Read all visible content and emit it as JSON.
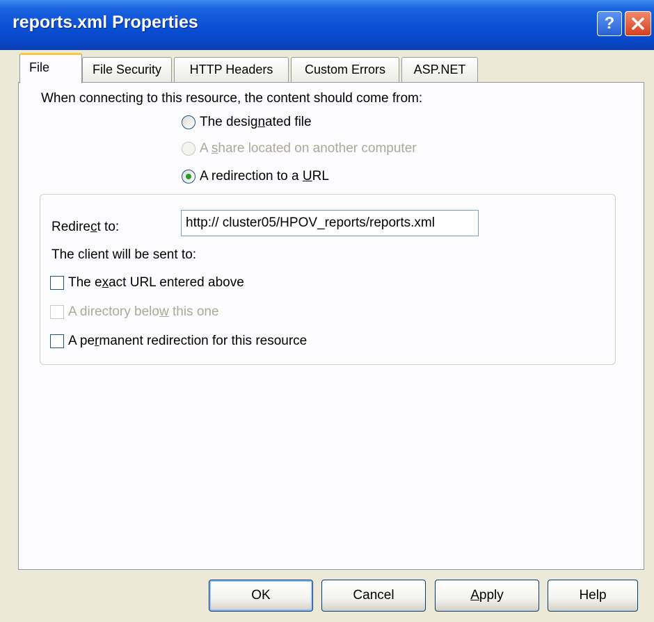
{
  "window": {
    "title": "reports.xml Properties",
    "help_glyph": "?",
    "titlebar_color": "#0a4fd4"
  },
  "tabs": [
    {
      "label": "File",
      "active": true
    },
    {
      "label": "File Security",
      "active": false
    },
    {
      "label": "HTTP Headers",
      "active": false
    },
    {
      "label": "Custom Errors",
      "active": false
    },
    {
      "label": "ASP.NET",
      "active": false
    }
  ],
  "content_source": {
    "intro": "When connecting to this resource, the content should come from:",
    "options": [
      {
        "pre": "The desig",
        "accel": "n",
        "post": "ated file",
        "selected": false,
        "enabled": true
      },
      {
        "pre": "A ",
        "accel": "s",
        "post": "hare located on another computer",
        "selected": false,
        "enabled": false
      },
      {
        "pre": "A redirection to a ",
        "accel": "U",
        "post": "RL",
        "selected": true,
        "enabled": true
      }
    ]
  },
  "redirect": {
    "label_pre": "Redire",
    "label_accel": "c",
    "label_post": "t to:",
    "url": "http:// cluster05/HPOV_reports/reports.xml",
    "client_label": "The client will be sent to:",
    "checkboxes": [
      {
        "pre": "The e",
        "accel": "x",
        "post": "act URL entered above",
        "checked": false,
        "enabled": true
      },
      {
        "pre": "A directory belo",
        "accel": "w",
        "post": " this one",
        "checked": false,
        "enabled": false
      },
      {
        "pre": "A pe",
        "accel": "r",
        "post": "manent redirection for this resource",
        "checked": false,
        "enabled": true
      }
    ]
  },
  "buttons": {
    "ok": "OK",
    "cancel": "Cancel",
    "apply_accel": "A",
    "apply_post": "pply",
    "help": "Help"
  }
}
